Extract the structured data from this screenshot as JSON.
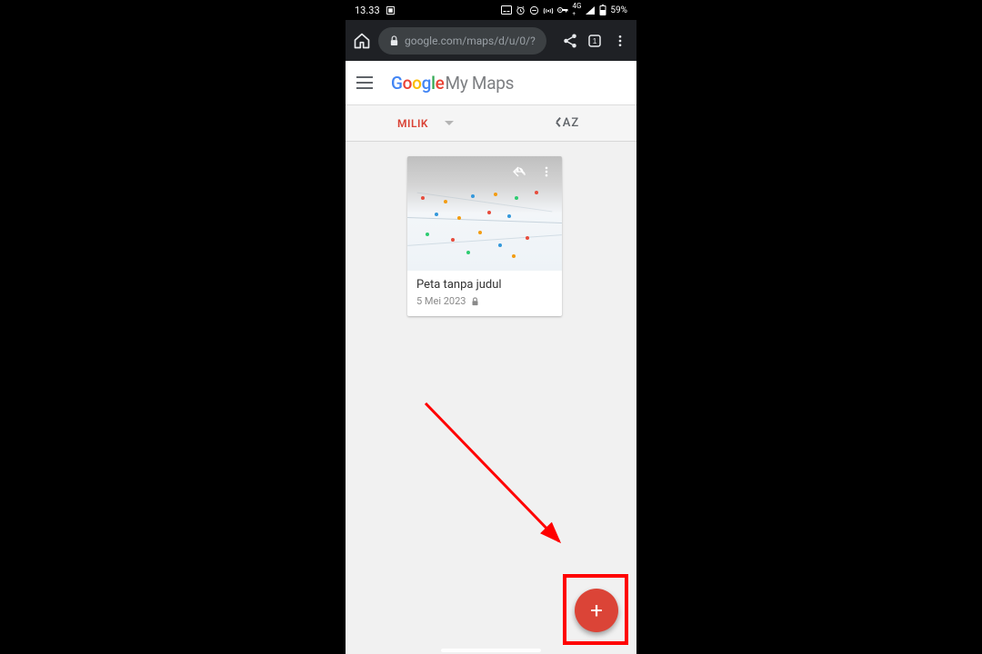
{
  "statusbar": {
    "time": "13.33",
    "battery_text": "59%",
    "network_label": "4G"
  },
  "chrome": {
    "url_display": "google.com/maps/d/u/0/?",
    "tab_count": "1"
  },
  "appheader": {
    "brand_suffix": "My Maps"
  },
  "filter": {
    "ownership_label": "MILIK",
    "sort_label": "AZ"
  },
  "maps": [
    {
      "title": "Peta tanpa judul",
      "date": "5 Mei 2023"
    }
  ],
  "fab": {
    "glyph": "+"
  }
}
